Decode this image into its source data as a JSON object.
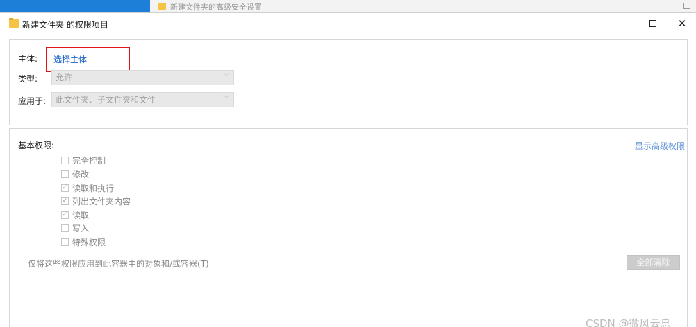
{
  "background_window": {
    "title": "新建文件夹的高级安全设置"
  },
  "dialog": {
    "title": "新建文件夹 的权限项目",
    "window_controls": {
      "minimize": "—",
      "maximize": "□",
      "close": "✕"
    }
  },
  "principal": {
    "label": "主体:",
    "select_link": "选择主体"
  },
  "type": {
    "label": "类型:",
    "value": "允许"
  },
  "applies_to": {
    "label": "应用于:",
    "value": "此文件夹、子文件夹和文件"
  },
  "basic_permissions": {
    "title": "基本权限:",
    "show_advanced": "显示高级权限",
    "items": [
      {
        "label": "完全控制",
        "checked": false
      },
      {
        "label": "修改",
        "checked": false
      },
      {
        "label": "读取和执行",
        "checked": true
      },
      {
        "label": "列出文件夹内容",
        "checked": true
      },
      {
        "label": "读取",
        "checked": true
      },
      {
        "label": "写入",
        "checked": false
      },
      {
        "label": "特殊权限",
        "checked": false
      }
    ]
  },
  "apply_only": {
    "label": "仅将这些权限应用到此容器中的对象和/或容器(T)",
    "checked": false
  },
  "clear_all_button": "全部清除",
  "watermark": "CSDN @微风云息",
  "colors": {
    "title_bar_accent": "#1e7fd8",
    "link": "#1a64c8",
    "highlight_box": "#e0151c",
    "folder_icon": "#f5c445"
  }
}
